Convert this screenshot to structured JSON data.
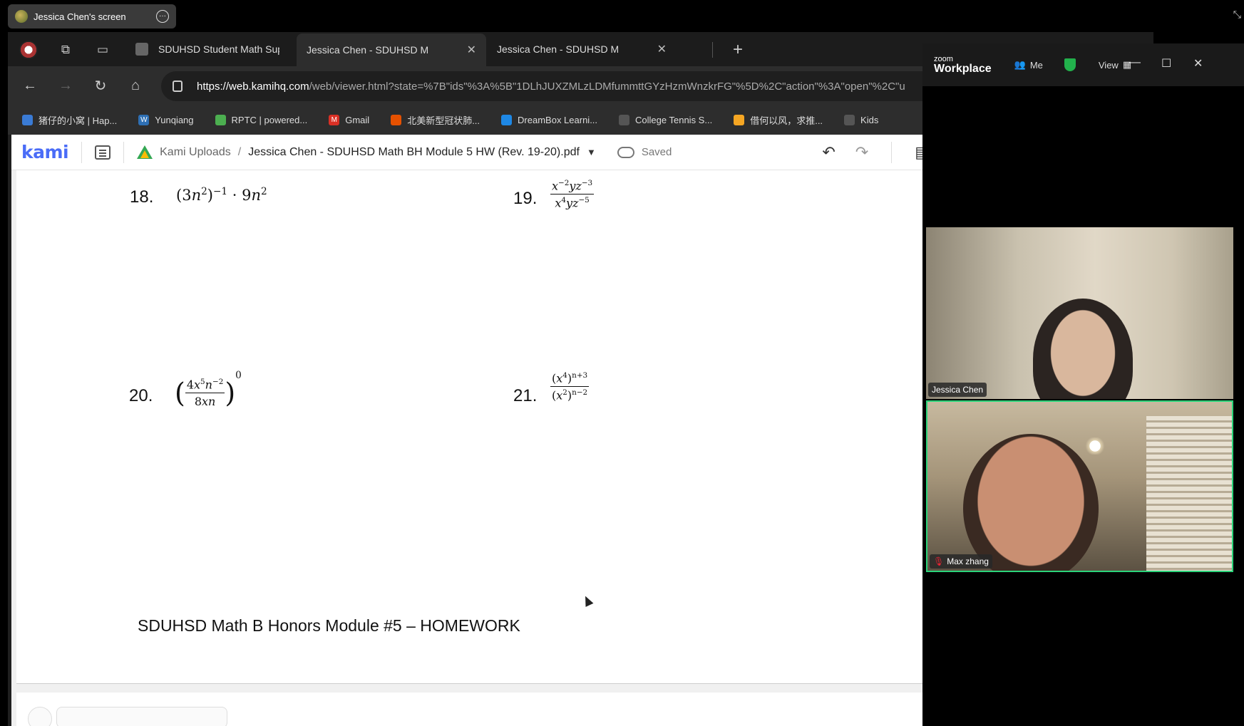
{
  "share_banner": {
    "label": "Jessica Chen's screen"
  },
  "browser": {
    "tabs": [
      {
        "title": "SDUHSD Student Math Sup",
        "favicon": "doc-icon",
        "active": false
      },
      {
        "title": "Jessica Chen - SDUHSD Ma",
        "favicon": "kami-icon",
        "active": true
      },
      {
        "title": "Jessica Chen - SDUHSD Ma",
        "favicon": "kami-icon",
        "active": false
      }
    ],
    "url": {
      "host": "https://web.kamihq.com",
      "path": "/web/viewer.html?state=%7B\"ids\"%3A%5B\"1DLhJUXZMLzLDMfummttGYzHzmWnzkrFG\"%5D%2C\"action\"%3A\"open\"%2C\"u"
    },
    "bookmarks": [
      {
        "label": "猪仔的小窝 | Hap...",
        "color": "#3a7bd5"
      },
      {
        "label": "Yunqiang",
        "color": "#2e6fb3"
      },
      {
        "label": "RPTC | powered...",
        "color": "#4caf50"
      },
      {
        "label": "Gmail",
        "color": "#d93025"
      },
      {
        "label": "北美新型冠状肺...",
        "color": "#e65100"
      },
      {
        "label": "DreamBox Learni...",
        "color": "#1e88e5"
      },
      {
        "label": "College Tennis S...",
        "color": "#555555"
      },
      {
        "label": "借何以风，求推...",
        "color": "#f5a623"
      },
      {
        "label": "Kids",
        "color": "#555555"
      }
    ]
  },
  "kami": {
    "logo": "kami",
    "breadcrumb_root": "Kami Uploads",
    "breadcrumb_sep": "/",
    "document_title": "Jessica Chen - SDUHSD Math BH Module 5 HW (Rev. 19-20).pdf",
    "save_status": "Saved",
    "accent": "#4a6cf7"
  },
  "document": {
    "problems": [
      {
        "number": "18."
      },
      {
        "number": "19."
      },
      {
        "number": "20."
      },
      {
        "number": "21."
      }
    ],
    "footer": "SDUHSD Math B Honors Module #5 – HOMEWORK",
    "page_fragment": "2"
  },
  "zoom": {
    "brand_small": "zoom",
    "brand_big": "Workplace",
    "meeting_label": "Me",
    "view_label": "View",
    "participants": [
      {
        "name": "Jessica Chen",
        "muted": false,
        "active_speaker": false
      },
      {
        "name": "Max zhang",
        "muted": true,
        "active_speaker": true
      }
    ],
    "active_border_color": "#2bd47a"
  }
}
